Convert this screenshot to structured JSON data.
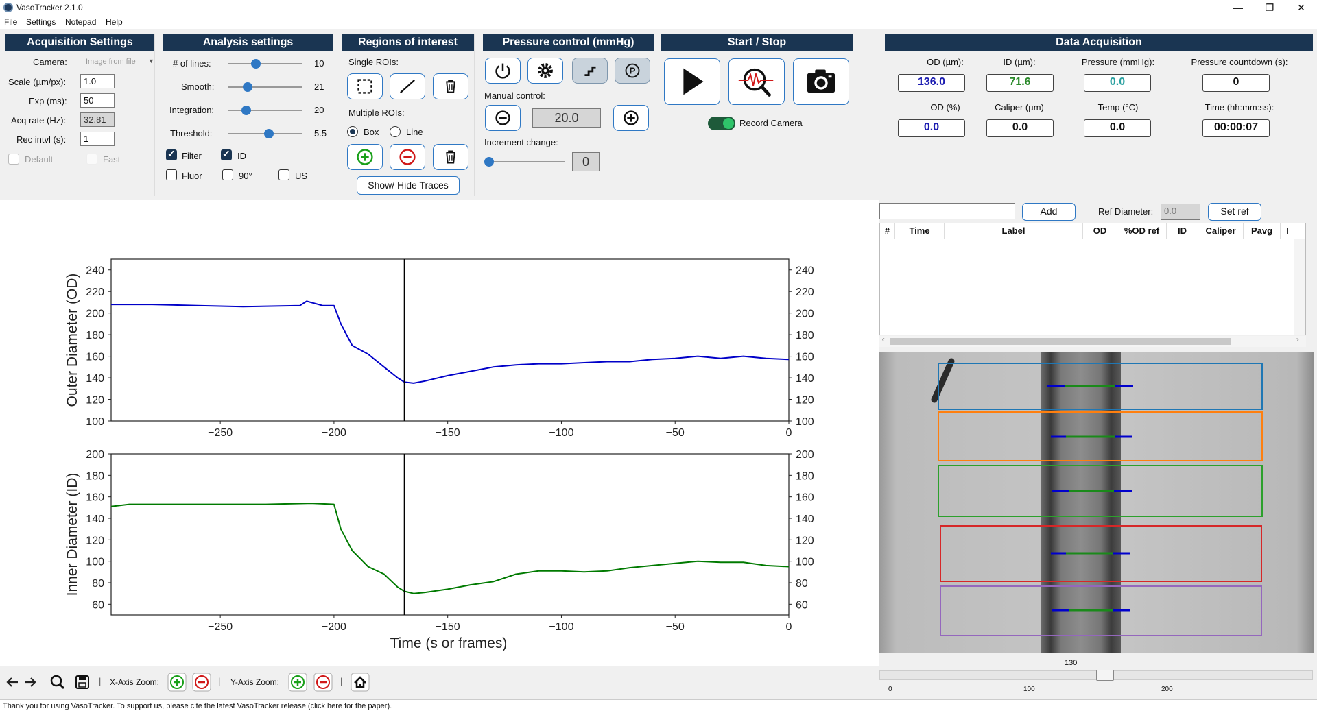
{
  "window": {
    "title": "VasoTracker 2.1.0",
    "minimize": "—",
    "restore": "❐",
    "close": "✕"
  },
  "menu": [
    "File",
    "Settings",
    "Notepad",
    "Help"
  ],
  "acquisition": {
    "title": "Acquisition Settings",
    "camera_label": "Camera:",
    "camera_value": "Image from file",
    "scale_label": "Scale (µm/px):",
    "scale_value": "1.0",
    "exp_label": "Exp (ms):",
    "exp_value": "50",
    "acq_label": "Acq rate (Hz):",
    "acq_value": "32.81",
    "rec_label": "Rec intvl (s):",
    "rec_value": "1",
    "default_label": "Default",
    "fast_label": "Fast"
  },
  "analysis": {
    "title": "Analysis settings",
    "lines_label": "# of lines:",
    "lines_value": "10",
    "lines_level": 0.35,
    "smooth_label": "Smooth:",
    "smooth_value": "21",
    "smooth_level": 0.22,
    "integration_label": "Integration:",
    "integration_value": "20",
    "integration_level": 0.2,
    "threshold_label": "Threshold:",
    "threshold_value": "5.5",
    "threshold_level": 0.55,
    "filter_label": "Filter",
    "id_label": "ID",
    "fluor_label": "Fluor",
    "deg_label": "90°",
    "us_label": "US"
  },
  "roi": {
    "title": "Regions of interest",
    "single_label": "Single ROIs:",
    "multiple_label": "Multiple ROIs:",
    "box_label": "Box",
    "line_label": "Line",
    "traces_button": "Show/ Hide Traces"
  },
  "pressure": {
    "title": "Pressure control (mmHg)",
    "manual_label": "Manual control:",
    "manual_value": "20.0",
    "increment_label": "Increment change:",
    "increment_value": "0",
    "increment_level": 0.0
  },
  "startstop": {
    "title": "Start / Stop",
    "record_label": "Record Camera"
  },
  "data_acq": {
    "title": "Data Acquisition",
    "od_label": "OD (µm):",
    "od_value": "136.0",
    "id_label": "ID (µm):",
    "id_value": "71.6",
    "pressure_label": "Pressure (mmHg):",
    "pressure_value": "0.0",
    "countdown_label": "Pressure countdown (s):",
    "countdown_value": "0",
    "odpct_label": "OD (%)",
    "odpct_value": "0.0",
    "caliper_label": "Caliper (µm)",
    "caliper_value": "0.0",
    "temp_label": "Temp (°C)",
    "temp_value": "0.0",
    "time_label": "Time (hh:mm:ss):",
    "time_value": "00:00:07",
    "colors": {
      "od": "#1a1ab0",
      "id": "#2a8a2a",
      "pressure": "#2aa0a0",
      "time": "#111111"
    }
  },
  "table": {
    "add_button": "Add",
    "ref_label": "Ref Diameter:",
    "ref_value": "0.0",
    "setref_button": "Set ref",
    "columns": [
      "#",
      "Time",
      "Label",
      "OD",
      "%OD ref",
      "ID",
      "Caliper",
      "Pavg",
      "I"
    ]
  },
  "image_slider": {
    "value": "130",
    "ticks": [
      "0",
      "100",
      "200"
    ],
    "level": 0.52
  },
  "nav_toolbar": {
    "xzoom_label": "X-Axis Zoom:",
    "yzoom_label": "Y-Axis Zoom:"
  },
  "status": "Thank you for using VasoTracker. To support us, please cite the latest VasoTracker release (click here for the paper).",
  "chart_data": [
    {
      "type": "line",
      "ylabel": "Outer Diameter (OD)",
      "xlim": [
        -298,
        0
      ],
      "ylim": [
        100,
        250
      ],
      "xticks": [
        "-250",
        "-200",
        "-150",
        "-100",
        "-50",
        "0"
      ],
      "yticks": [
        "100",
        "120",
        "140",
        "160",
        "180",
        "200",
        "220",
        "240"
      ],
      "cursor_x": -169,
      "color": "#0000c8",
      "x": [
        -298,
        -280,
        -260,
        -240,
        -215,
        -212,
        -205,
        -200,
        -197,
        -192,
        -185,
        -178,
        -172,
        -169,
        -165,
        -160,
        -150,
        -140,
        -130,
        -120,
        -110,
        -100,
        -90,
        -80,
        -70,
        -60,
        -50,
        -40,
        -30,
        -20,
        -10,
        0
      ],
      "y": [
        208,
        208,
        207,
        206,
        207,
        211,
        207,
        207,
        190,
        170,
        162,
        150,
        140,
        136,
        135,
        137,
        142,
        146,
        150,
        152,
        153,
        153,
        154,
        155,
        155,
        157,
        158,
        160,
        158,
        160,
        158,
        157
      ]
    },
    {
      "type": "line",
      "ylabel": "Inner Diameter (ID)",
      "xlabel": "Time (s or frames)",
      "xlim": [
        -298,
        0
      ],
      "ylim": [
        50,
        200
      ],
      "xticks": [
        "-250",
        "-200",
        "-150",
        "-100",
        "-50",
        "0"
      ],
      "yticks": [
        "60",
        "80",
        "100",
        "120",
        "140",
        "160",
        "180",
        "200"
      ],
      "cursor_x": -169,
      "color": "#007a00",
      "x": [
        -298,
        -290,
        -270,
        -250,
        -230,
        -210,
        -200,
        -197,
        -192,
        -185,
        -178,
        -172,
        -169,
        -165,
        -160,
        -150,
        -140,
        -130,
        -120,
        -110,
        -100,
        -90,
        -80,
        -70,
        -60,
        -50,
        -40,
        -30,
        -20,
        -10,
        0
      ],
      "y": [
        151,
        153,
        153,
        153,
        153,
        154,
        153,
        130,
        110,
        95,
        88,
        76,
        72,
        70,
        71,
        74,
        78,
        81,
        88,
        91,
        91,
        90,
        91,
        94,
        96,
        98,
        100,
        99,
        99,
        96,
        95
      ]
    }
  ]
}
